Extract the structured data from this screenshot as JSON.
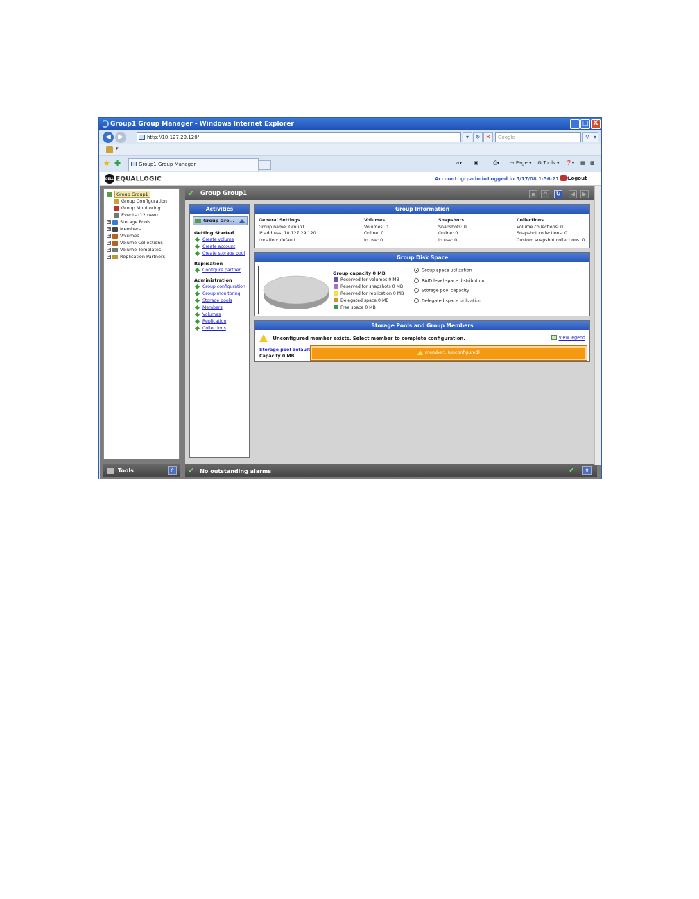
{
  "window": {
    "title": "Group1 Group Manager - Windows Internet Explorer",
    "buttons": {
      "minimize": "_",
      "maximize": "□",
      "close": "X"
    }
  },
  "addressbar": {
    "back": "◀",
    "forward": "▶",
    "url": "http://10.127.29.120/",
    "search_placeholder": "Google"
  },
  "tabs": [
    {
      "label": "Group1 Group Manager"
    }
  ],
  "commandbar": {
    "page": "Page",
    "tools": "Tools"
  },
  "app": {
    "logo_text": "EQUALLOGIC",
    "dell_text": "DELL",
    "account": "Account: grpadmin",
    "logged_in": "Logged in 5/17/08 1:56:21 PM",
    "logout": "Logout"
  },
  "tree": [
    {
      "label": "Group Group1",
      "selected": true,
      "expander": false,
      "indent": 0,
      "color": "#5d9a45"
    },
    {
      "label": "Group Configuration",
      "expander": false,
      "indent": 1,
      "color": "#c9a23a"
    },
    {
      "label": "Group Monitoring",
      "expander": false,
      "indent": 1,
      "color": "#c0302c"
    },
    {
      "label": "Events (12 new)",
      "expander": false,
      "indent": 1,
      "color": "#777777"
    },
    {
      "label": "Storage Pools",
      "expander": true,
      "indent": 0,
      "color": "#3a7bd5"
    },
    {
      "label": "Members",
      "expander": true,
      "indent": 0,
      "color": "#444444"
    },
    {
      "label": "Volumes",
      "expander": true,
      "indent": 0,
      "color": "#b5651d"
    },
    {
      "label": "Volume Collections",
      "expander": true,
      "indent": 0,
      "color": "#b5651d"
    },
    {
      "label": "Volume Templates",
      "expander": true,
      "indent": 0,
      "color": "#777777"
    },
    {
      "label": "Replication Partners",
      "expander": true,
      "indent": 0,
      "color": "#b59a3a"
    }
  ],
  "group_bar": {
    "title": "Group Group1"
  },
  "activities": {
    "title": "Activities",
    "sub_title": "Group Gro...",
    "sections": [
      {
        "title": "Getting Started",
        "links": [
          "Create volume",
          "Create account",
          "Create storage pool"
        ]
      },
      {
        "title": "Replication",
        "links": [
          "Configure partner"
        ]
      },
      {
        "title": "Administration",
        "links": [
          "Group configuration",
          "Group monitoring",
          "Storage pools",
          "Members",
          "Volumes",
          "Replication",
          "Collections"
        ]
      }
    ]
  },
  "group_info": {
    "title": "Group Information",
    "columns": [
      {
        "header": "General Settings",
        "rows": [
          "Group name:  Group1",
          "IP address:  10.127.29.120",
          "Location:  default"
        ]
      },
      {
        "header": "Volumes",
        "rows": [
          "Volumes:  0",
          "Online:  0",
          "In use:  0"
        ]
      },
      {
        "header": "Snapshots",
        "rows": [
          "Snapshots:  0",
          "Online:  0",
          "In use:  0"
        ]
      },
      {
        "header": "Collections",
        "rows": [
          "Volume collections:  0",
          "Snapshot collections:  0",
          "Custom snapshot collections:  0"
        ]
      }
    ]
  },
  "disk_space": {
    "title": "Group Disk Space",
    "capacity_title": "Group capacity 0 MB",
    "legend": [
      {
        "label": "Reserved for volumes 0 MB",
        "color": "#6a4fb5"
      },
      {
        "label": "Reserved for snapshots 0 MB",
        "color": "#b06ac9"
      },
      {
        "label": "Reserved for replication 0 MB",
        "color": "#f5e042"
      },
      {
        "label": "Delegated space 0 MB",
        "color": "#e8862a"
      },
      {
        "label": "Free space 0 MB",
        "color": "#2ea043"
      }
    ],
    "options": [
      {
        "label": "Group space utilization",
        "selected": true
      },
      {
        "label": "RAID level space distribution",
        "selected": false
      },
      {
        "label": "Storage pool capacity",
        "selected": false
      },
      {
        "label": "Delegated space utilization",
        "selected": false
      }
    ]
  },
  "pools": {
    "title": "Storage Pools and Group Members",
    "warning": "Unconfigured member exists. Select member to complete configuration.",
    "view_legend": "View legend",
    "pool_name": "Storage pool default",
    "pool_capacity": "Capacity 0 MB",
    "member_label": "member1 (unconfigured)"
  },
  "bottom": {
    "tools": "Tools",
    "alarms": "No outstanding alarms"
  }
}
